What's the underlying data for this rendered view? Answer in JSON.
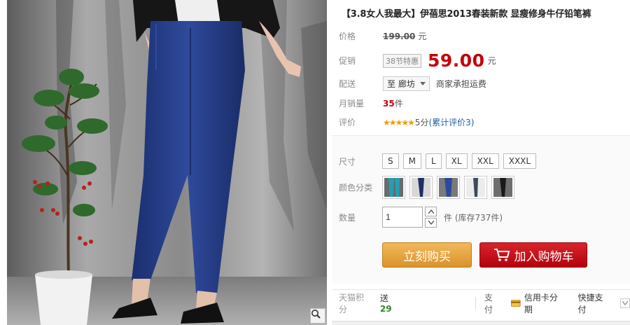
{
  "product": {
    "title": "【3.8女人我最大】伊蓓思2013春装新款 显瘦修身牛仔铅笔裤",
    "price_label": "价格",
    "original_price": "199.00",
    "price_unit": "元",
    "promo_label": "促销",
    "promo_tag": "38节特惠",
    "promo_price": "59.00",
    "delivery_label": "配送",
    "delivery_location": "至 廊坊",
    "delivery_note": "商家承担运费",
    "sales_label": "月销量",
    "sales_count": "35",
    "sales_unit": "件",
    "rating_label": "评价",
    "rating_stars": "★★★★★",
    "rating_score": "5分",
    "rating_reviews": "(累计评价3)"
  },
  "sku": {
    "size_label": "尺寸",
    "sizes": [
      "S",
      "M",
      "L",
      "XL",
      "XXL",
      "XXXL"
    ],
    "color_label": "颜色分类",
    "colors": [
      "teal-jeans",
      "navy-jeans",
      "blue-jeans",
      "gray-jeans",
      "black-jeans"
    ],
    "quantity_label": "数量",
    "quantity_value": "1",
    "stock_text": "件 (库存737件)"
  },
  "actions": {
    "buy_now": "立刻购买",
    "add_to_cart": "加入购物车"
  },
  "footer": {
    "points_label": "天猫积分",
    "points_prefix": "送",
    "points_value": "29",
    "payment_label": "支付",
    "card_installment": "信用卡分期",
    "quick_pay": "快捷支付"
  },
  "icons": {
    "zoom": "magnifier-icon",
    "cart": "shopping-cart-icon",
    "card": "credit-card-icon"
  },
  "colors": {
    "price_red": "#c4000a",
    "buy_orange": "#e3a040",
    "cart_red": "#c4101a",
    "link_blue": "#1d5ea8"
  }
}
